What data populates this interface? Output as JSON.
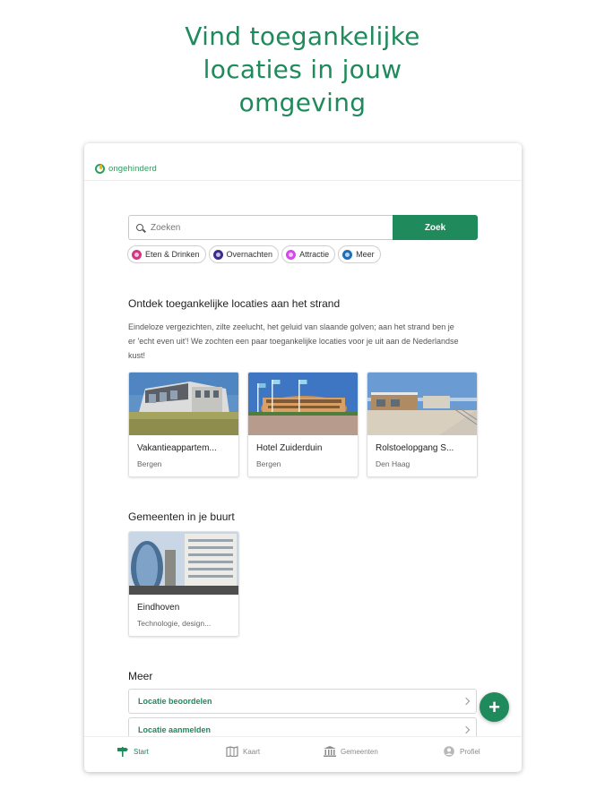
{
  "headline": {
    "line1": "Vind toegankelijke",
    "line2": "locaties in jouw",
    "line3": "omgeving"
  },
  "app": {
    "logo_text": "ongehinderd"
  },
  "search": {
    "placeholder": "Zoeken",
    "value": "",
    "button_label": "Zoek"
  },
  "chips": [
    {
      "label": "Eten & Drinken",
      "color": "#d63384"
    },
    {
      "label": "Overnachten",
      "color": "#3a2d8f"
    },
    {
      "label": "Attractie",
      "color": "#d946ef"
    },
    {
      "label": "Meer",
      "color": "#1e6fb8"
    }
  ],
  "beach": {
    "title": "Ontdek toegankelijke locaties aan het strand",
    "description": "Eindeloze vergezichten, zilte zeelucht, het geluid van slaande golven; aan het strand ben je er 'echt even uit'! We zochten een paar toegankelijke locaties voor je uit aan de Nederlandse kust!",
    "cards": [
      {
        "title": "Vakantieappartem...",
        "subtitle": "Bergen"
      },
      {
        "title": "Hotel Zuiderduin",
        "subtitle": "Bergen"
      },
      {
        "title": "Rolstoelopgang S...",
        "subtitle": "Den Haag"
      }
    ]
  },
  "municipalities": {
    "title": "Gemeenten in je buurt",
    "cards": [
      {
        "title": "Eindhoven",
        "subtitle": "Technologie, design..."
      }
    ]
  },
  "more": {
    "title": "Meer",
    "items": [
      {
        "label": "Locatie beoordelen"
      },
      {
        "label": "Locatie aanmelden"
      }
    ]
  },
  "fab": {
    "label": "+"
  },
  "bottom_nav": [
    {
      "label": "Start",
      "icon": "signpost-icon",
      "active": true
    },
    {
      "label": "Kaart",
      "icon": "map-icon",
      "active": false
    },
    {
      "label": "Gemeenten",
      "icon": "town-hall-icon",
      "active": false
    },
    {
      "label": "Profiel",
      "icon": "profile-icon",
      "active": false
    }
  ],
  "colors": {
    "brand_green": "#1f8a5b",
    "logo_yellow": "#f2b705"
  }
}
